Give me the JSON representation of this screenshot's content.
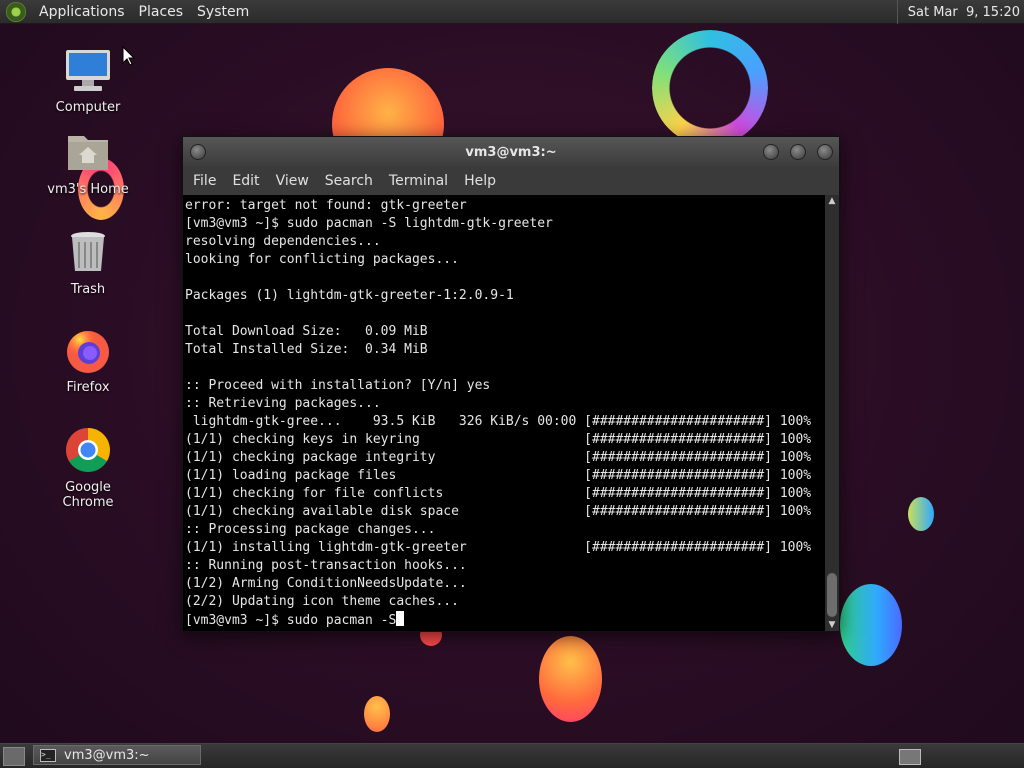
{
  "top_panel": {
    "menus": [
      "Applications",
      "Places",
      "System"
    ],
    "clock": "Sat Mar  9, 15:20"
  },
  "desktop_icons": [
    {
      "label": "Computer",
      "icon": "computer-icon"
    },
    {
      "label": "vm3's Home",
      "icon": "home-folder-icon"
    },
    {
      "label": "Trash",
      "icon": "trash-icon"
    },
    {
      "label": "Firefox",
      "icon": "firefox-icon"
    },
    {
      "label": "Google Chrome",
      "icon": "chrome-icon"
    }
  ],
  "window": {
    "title": "vm3@vm3:~",
    "menu": [
      "File",
      "Edit",
      "View",
      "Search",
      "Terminal",
      "Help"
    ]
  },
  "terminal": {
    "lines": [
      "error: target not found: gtk-greeter",
      "[vm3@vm3 ~]$ sudo pacman -S lightdm-gtk-greeter",
      "resolving dependencies...",
      "looking for conflicting packages...",
      "",
      "Packages (1) lightdm-gtk-greeter-1:2.0.9-1",
      "",
      "Total Download Size:   0.09 MiB",
      "Total Installed Size:  0.34 MiB",
      "",
      ":: Proceed with installation? [Y/n] yes",
      ":: Retrieving packages...",
      " lightdm-gtk-gree...    93.5 KiB   326 KiB/s 00:00 [######################] 100%",
      "(1/1) checking keys in keyring                     [######################] 100%",
      "(1/1) checking package integrity                   [######################] 100%",
      "(1/1) loading package files                        [######################] 100%",
      "(1/1) checking for file conflicts                  [######################] 100%",
      "(1/1) checking available disk space                [######################] 100%",
      ":: Processing package changes...",
      "(1/1) installing lightdm-gtk-greeter               [######################] 100%",
      ":: Running post-transaction hooks...",
      "(1/2) Arming ConditionNeedsUpdate...",
      "(2/2) Updating icon theme caches..."
    ],
    "prompt": "[vm3@vm3 ~]$ sudo pacman -S"
  },
  "taskbar": {
    "task_label": "vm3@vm3:~"
  },
  "colors": {
    "background": "#2a0d24",
    "terminal_bg": "#000000",
    "terminal_fg": "#e6e6e6"
  }
}
